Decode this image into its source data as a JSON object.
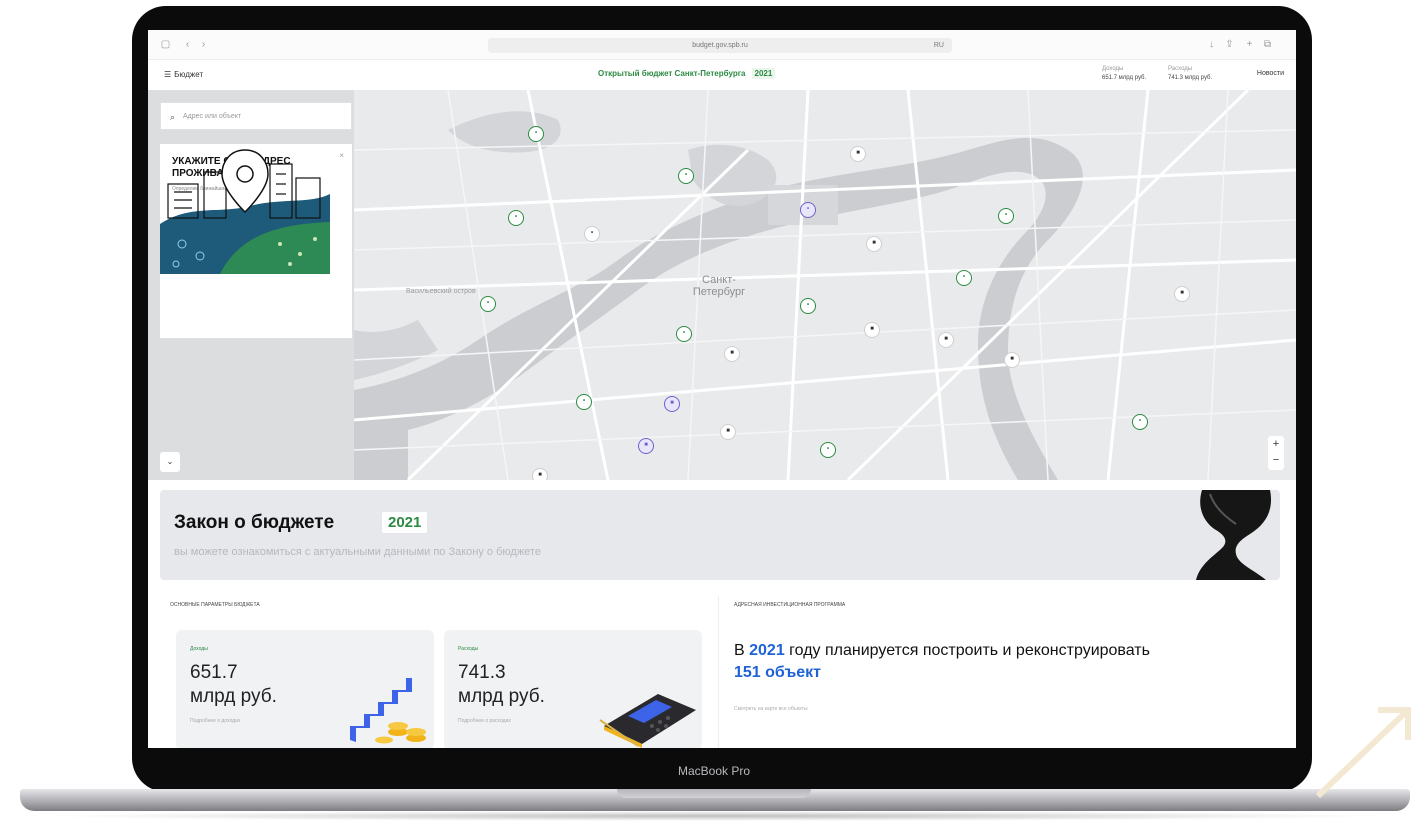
{
  "device": {
    "label": "MacBook Pro"
  },
  "browser": {
    "url": "budget.gov.spb.ru",
    "url_tail": "RU"
  },
  "header": {
    "brand": "Бюджет",
    "title": "Открытый бюджет Санкт-Петербурга",
    "year": "2021",
    "stats": [
      {
        "label": "Доходы",
        "value": "651.7 млрд руб."
      },
      {
        "label": "Расходы",
        "value": "741.3 млрд руб."
      }
    ],
    "link": "Новости"
  },
  "map": {
    "search_placeholder": "Адрес или объект",
    "card_title": "УКАЖИТЕ СВОЙ АДРЕС ПРОЖИВАНИЯ",
    "card_subtitle": "Определим ближайшие объекты",
    "city_label": "Санкт-Петербург",
    "district_label": "Васильевский остров",
    "pin_green_symbol": "•",
    "pin_dark_symbol": "■"
  },
  "banner": {
    "title": "Закон о бюджете",
    "year": "2021",
    "subtitle": "вы можете ознакомиться с актуальными данными по Закону о бюджете"
  },
  "budget": {
    "section_label": "ОСНОВНЫЕ ПАРАМЕТРЫ БЮДЖЕТА",
    "cards": [
      {
        "kind": "Доходы",
        "value": "651.7",
        "unit": "млрд руб.",
        "note": "Подробнее о доходах"
      },
      {
        "kind": "Расходы",
        "value": "741.3",
        "unit": "млрд руб.",
        "note": "Подробнее о расходах"
      }
    ]
  },
  "program": {
    "section_label": "АДРЕСНАЯ ИНВЕСТИЦИОННАЯ ПРОГРАММА",
    "text_before": "В ",
    "year": "2021",
    "text_middle": " году планируется построить и реконструировать ",
    "count": "151 объект",
    "note": "Смотреть на карте все объекты"
  },
  "colors": {
    "accent_green": "#2c8a43",
    "accent_blue": "#1e63d6",
    "pin_purple": "#6b63c9"
  }
}
